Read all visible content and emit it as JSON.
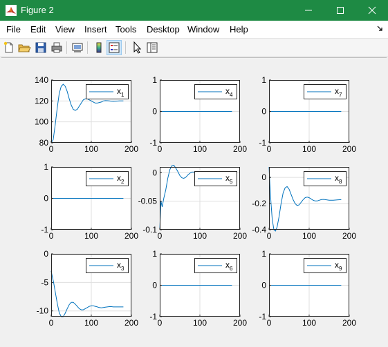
{
  "window": {
    "title": "Figure 2",
    "controls": [
      "minimize",
      "maximize",
      "close"
    ],
    "titlebar_color": "#1e8a44"
  },
  "menu": [
    "File",
    "Edit",
    "View",
    "Insert",
    "Tools",
    "Desktop",
    "Window",
    "Help"
  ],
  "toolbar": [
    "new-figure",
    "open-file",
    "save-figure",
    "print-figure",
    "print-preview",
    "insert-colorbar",
    "insert-legend",
    "edit-plot",
    "property-inspector"
  ],
  "plot_color": "#0072bd",
  "chart_data": [
    {
      "type": "line",
      "legend": "x",
      "sub": "1",
      "xlim": [
        0,
        200
      ],
      "ylim": [
        80,
        140
      ],
      "xticks": [
        "0",
        "100",
        "200"
      ],
      "yticks": [
        "80",
        "100",
        "120",
        "140"
      ],
      "grid": true,
      "legend_position": "top-right",
      "x": [
        0,
        5,
        10,
        15,
        20,
        25,
        30,
        35,
        40,
        45,
        50,
        55,
        60,
        65,
        70,
        75,
        80,
        85,
        90,
        95,
        100,
        105,
        110,
        115,
        120,
        125,
        130,
        135,
        140,
        145,
        150,
        155,
        160,
        165,
        170,
        175,
        180
      ],
      "y": [
        80,
        83,
        97,
        113,
        127,
        134,
        136,
        134,
        129,
        122,
        116,
        112,
        111,
        112,
        115,
        118,
        121,
        122,
        122,
        121,
        120,
        119,
        118,
        118,
        118.5,
        119,
        120,
        120.3,
        120.2,
        120,
        119.7,
        119.6,
        119.7,
        119.9,
        120,
        120,
        120
      ]
    },
    {
      "type": "line",
      "legend": "x",
      "sub": "4",
      "xlim": [
        0,
        200
      ],
      "ylim": [
        -1,
        1
      ],
      "xticks": [
        "0",
        "100",
        "200"
      ],
      "yticks": [
        "-1",
        "0",
        "1"
      ],
      "grid": true,
      "legend_position": "top-right",
      "x": [
        0,
        180
      ],
      "y": [
        0,
        0
      ]
    },
    {
      "type": "line",
      "legend": "x",
      "sub": "7",
      "xlim": [
        0,
        200
      ],
      "ylim": [
        -1,
        1
      ],
      "xticks": [
        "0",
        "100",
        "200"
      ],
      "yticks": [
        "-1",
        "0",
        "1"
      ],
      "grid": true,
      "legend_position": "top-right",
      "x": [
        0,
        180
      ],
      "y": [
        0,
        0
      ]
    },
    {
      "type": "line",
      "legend": "x",
      "sub": "2",
      "xlim": [
        0,
        200
      ],
      "ylim": [
        -1,
        1
      ],
      "xticks": [
        "0",
        "100",
        "200"
      ],
      "yticks": [
        "-1",
        "0",
        "1"
      ],
      "grid": true,
      "legend_position": "top-right",
      "x": [
        0,
        180
      ],
      "y": [
        0,
        0
      ]
    },
    {
      "type": "line",
      "legend": "x",
      "sub": "5",
      "xlim": [
        0,
        200
      ],
      "ylim": [
        -0.1,
        0.01
      ],
      "xticks": [
        "0",
        "100",
        "200"
      ],
      "yticks": [
        "-0.1",
        "-0.05",
        "0"
      ],
      "grid": true,
      "legend_position": "top-right",
      "x": [
        0,
        3,
        6,
        10,
        15,
        20,
        25,
        30,
        35,
        40,
        45,
        50,
        55,
        60,
        65,
        70,
        75,
        80,
        85,
        90,
        95,
        100,
        110,
        120,
        130,
        140,
        150,
        160,
        170,
        180
      ],
      "y": [
        -0.1,
        -0.05,
        -0.06,
        -0.045,
        -0.03,
        -0.01,
        0.005,
        0.012,
        0.013,
        0.008,
        0.002,
        -0.005,
        -0.009,
        -0.01,
        -0.008,
        -0.004,
        -0.001,
        0.001,
        0.001,
        0,
        -0.001,
        -0.001,
        0,
        0,
        0,
        0,
        0,
        0,
        0,
        0
      ]
    },
    {
      "type": "line",
      "legend": "x",
      "sub": "8",
      "xlim": [
        0,
        200
      ],
      "ylim": [
        -0.4,
        0.08
      ],
      "xticks": [
        "0",
        "100",
        "200"
      ],
      "yticks": [
        "-0.4",
        "-0.2",
        "0"
      ],
      "grid": true,
      "legend_position": "top-right",
      "x": [
        0,
        2,
        5,
        8,
        12,
        16,
        20,
        25,
        30,
        35,
        40,
        45,
        50,
        55,
        60,
        65,
        70,
        75,
        80,
        85,
        90,
        95,
        100,
        105,
        110,
        115,
        120,
        125,
        130,
        135,
        140,
        150,
        160,
        170,
        180
      ],
      "y": [
        0.08,
        -0.05,
        -0.2,
        -0.32,
        -0.4,
        -0.41,
        -0.38,
        -0.3,
        -0.2,
        -0.12,
        -0.08,
        -0.07,
        -0.09,
        -0.13,
        -0.17,
        -0.2,
        -0.215,
        -0.21,
        -0.19,
        -0.17,
        -0.155,
        -0.15,
        -0.155,
        -0.165,
        -0.175,
        -0.18,
        -0.18,
        -0.175,
        -0.17,
        -0.168,
        -0.17,
        -0.174,
        -0.175,
        -0.172,
        -0.17
      ]
    },
    {
      "type": "line",
      "legend": "x",
      "sub": "3",
      "xlim": [
        0,
        200
      ],
      "ylim": [
        -11,
        0
      ],
      "xticks": [
        "0",
        "100",
        "200"
      ],
      "yticks": [
        "-10",
        "-5",
        "0"
      ],
      "grid": true,
      "legend_position": "top-right",
      "x": [
        0,
        3,
        6,
        10,
        15,
        20,
        25,
        30,
        35,
        40,
        45,
        50,
        55,
        60,
        65,
        70,
        75,
        80,
        85,
        90,
        95,
        100,
        105,
        110,
        115,
        120,
        125,
        130,
        135,
        140,
        145,
        150,
        155,
        160,
        165,
        170,
        175,
        180
      ],
      "y": [
        -3,
        -4,
        -5,
        -6.6,
        -8.6,
        -10.3,
        -11,
        -11,
        -10.4,
        -9.6,
        -8.9,
        -8.5,
        -8.5,
        -8.8,
        -9.2,
        -9.6,
        -9.8,
        -9.8,
        -9.6,
        -9.4,
        -9.2,
        -9.1,
        -9.1,
        -9.2,
        -9.3,
        -9.4,
        -9.45,
        -9.4,
        -9.35,
        -9.3,
        -9.25,
        -9.25,
        -9.3,
        -9.3,
        -9.3,
        -9.3,
        -9.3,
        -9.3
      ]
    },
    {
      "type": "line",
      "legend": "x",
      "sub": "6",
      "xlim": [
        0,
        200
      ],
      "ylim": [
        -1,
        1
      ],
      "xticks": [
        "0",
        "100",
        "200"
      ],
      "yticks": [
        "-1",
        "0",
        "1"
      ],
      "grid": true,
      "legend_position": "top-right",
      "x": [
        0,
        180
      ],
      "y": [
        0,
        0
      ]
    },
    {
      "type": "line",
      "legend": "x",
      "sub": "9",
      "xlim": [
        0,
        200
      ],
      "ylim": [
        -1,
        1
      ],
      "xticks": [
        "0",
        "100",
        "200"
      ],
      "yticks": [
        "-1",
        "0",
        "1"
      ],
      "grid": true,
      "legend_position": "top-right",
      "x": [
        0,
        180
      ],
      "y": [
        0,
        0
      ]
    }
  ]
}
